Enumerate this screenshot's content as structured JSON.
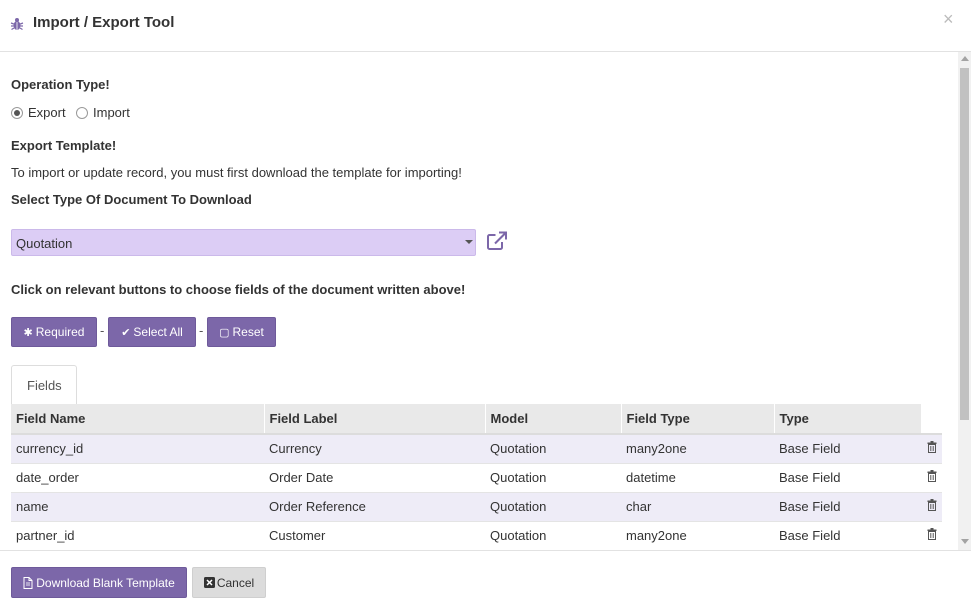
{
  "dialog": {
    "title": "Import / Export Tool",
    "close_symbol": "×",
    "accent_color": "#7c67a9"
  },
  "operation": {
    "label": "Operation Type!",
    "options": [
      {
        "label": "Export",
        "checked": true
      },
      {
        "label": "Import",
        "checked": false
      }
    ]
  },
  "template": {
    "heading": "Export Template!",
    "note": "To import or update record, you must first download the template for importing!",
    "select_label": "Select Type Of Document To Download",
    "selected_document": "Quotation"
  },
  "field_buttons": {
    "instruction": "Click on relevant buttons to choose fields of the document written above!",
    "required_label": "Required",
    "select_all_label": "Select All",
    "reset_label": "Reset",
    "separator": "-"
  },
  "tabs": [
    {
      "label": "Fields",
      "active": true
    }
  ],
  "table": {
    "columns": [
      "Field Name",
      "Field Label",
      "Model",
      "Field Type",
      "Type"
    ],
    "rows": [
      {
        "field_name": "currency_id",
        "field_label": "Currency",
        "model": "Quotation",
        "field_type": "many2one",
        "type": "Base Field"
      },
      {
        "field_name": "date_order",
        "field_label": "Order Date",
        "model": "Quotation",
        "field_type": "datetime",
        "type": "Base Field"
      },
      {
        "field_name": "name",
        "field_label": "Order Reference",
        "model": "Quotation",
        "field_type": "char",
        "type": "Base Field"
      },
      {
        "field_name": "partner_id",
        "field_label": "Customer",
        "model": "Quotation",
        "field_type": "many2one",
        "type": "Base Field"
      }
    ]
  },
  "footer": {
    "download_label": "Download Blank Template",
    "cancel_label": "Cancel"
  },
  "icons": {
    "bug": "bug-icon",
    "external_link": "external-link-icon",
    "asterisk": "asterisk-icon",
    "check": "check-icon",
    "square": "square-icon",
    "trash": "trash-icon",
    "file": "file-icon",
    "close_box": "close-box-icon"
  }
}
